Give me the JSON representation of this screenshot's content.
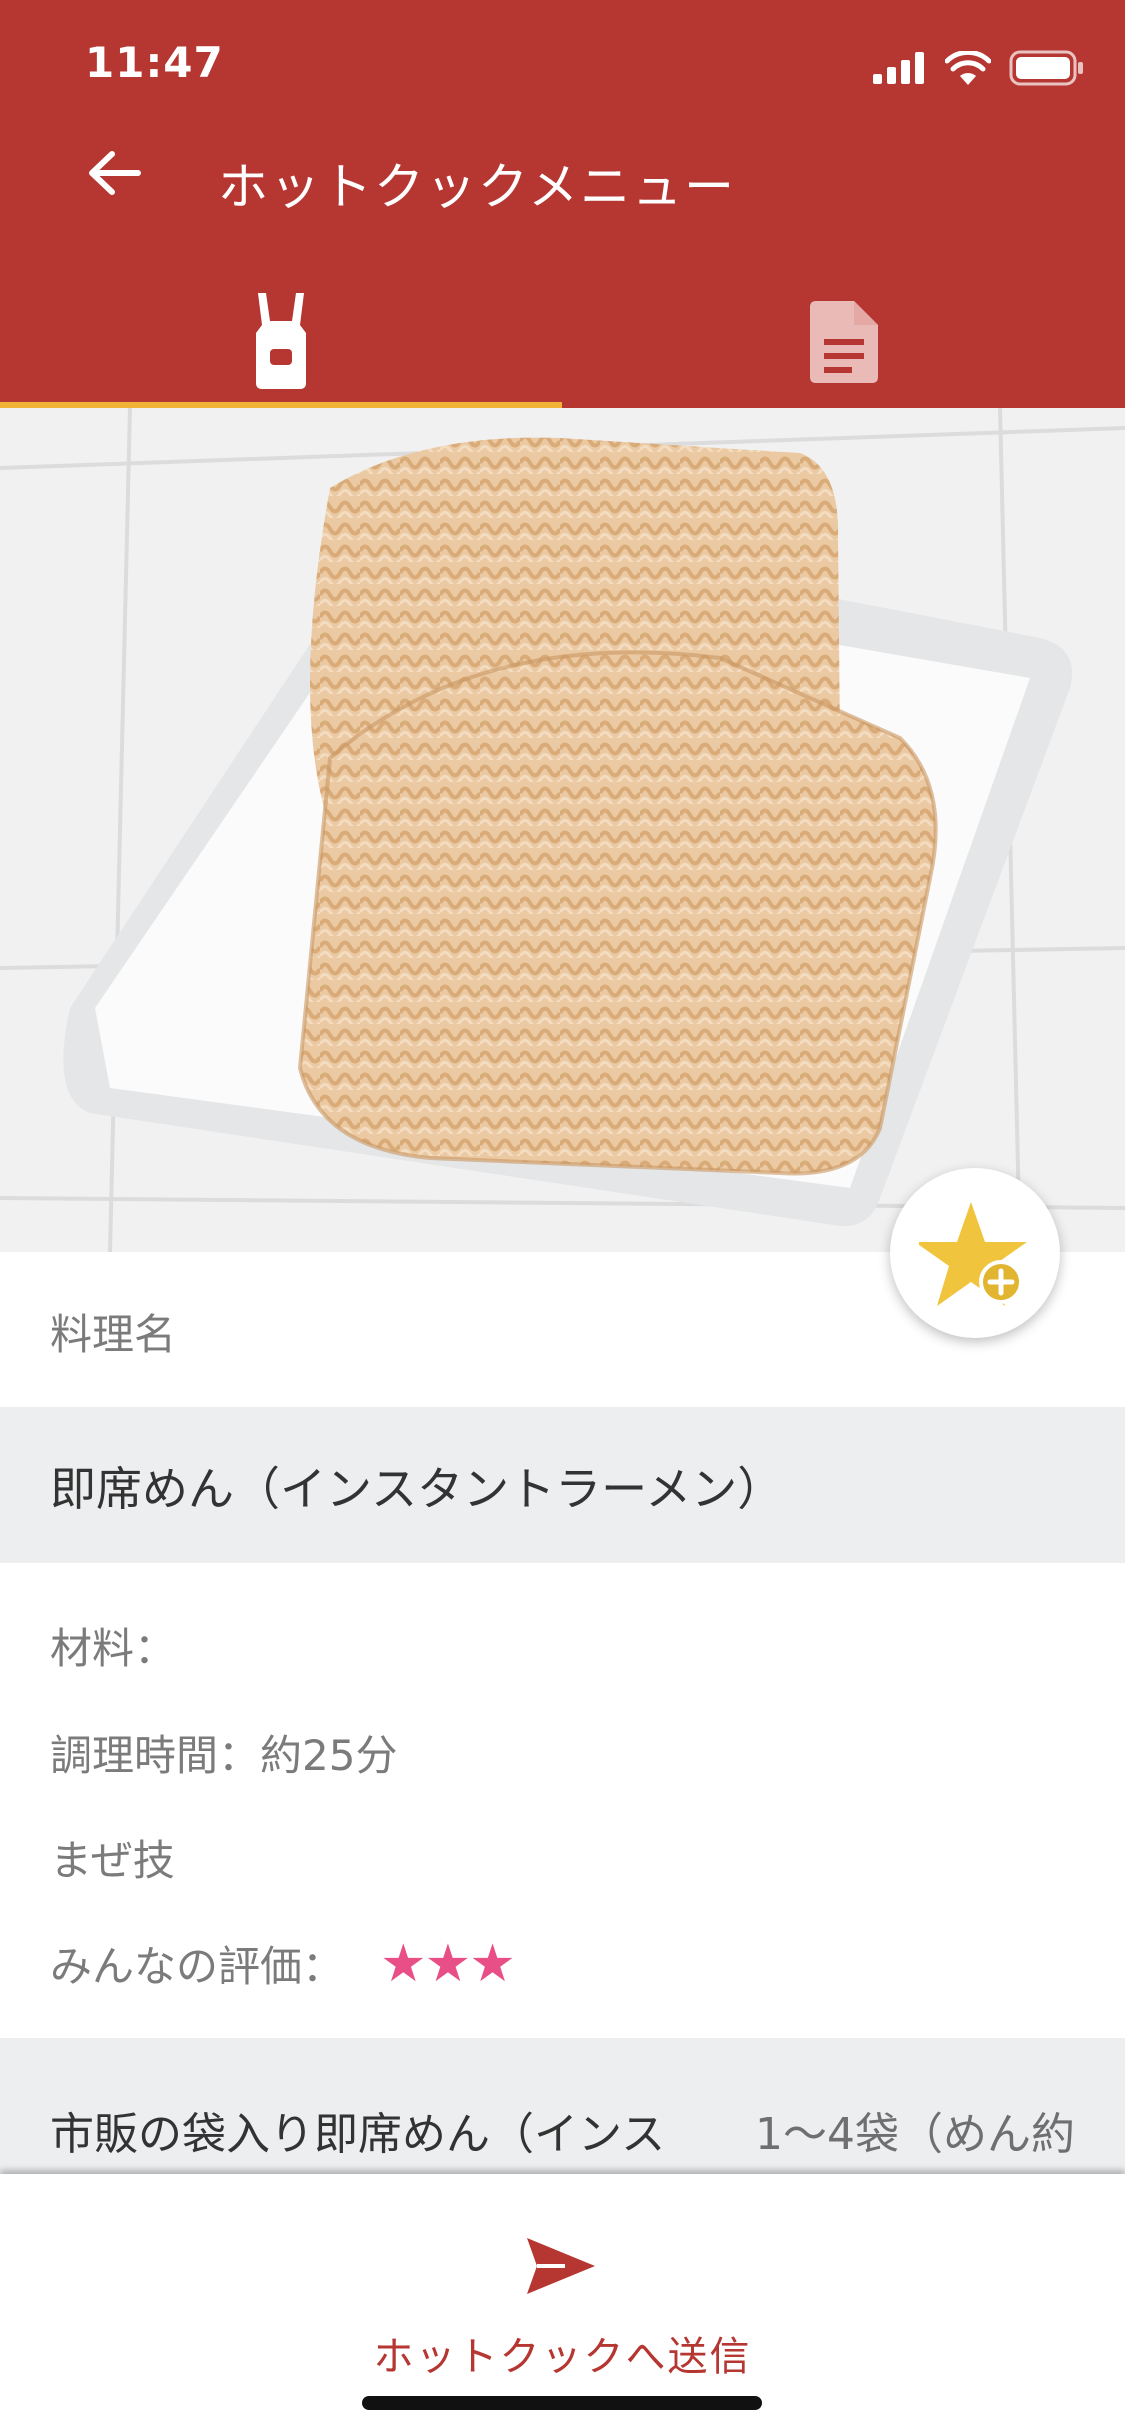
{
  "status": {
    "time": "11:47"
  },
  "header": {
    "title": "ホットクックメニュー"
  },
  "tabs": [
    {
      "icon": "apron-icon",
      "active": true
    },
    {
      "icon": "document-icon",
      "active": false
    }
  ],
  "recipe": {
    "name_label": "料理名",
    "name": "即席めん（インスタントラーメン）",
    "ingredients_label": "材料：",
    "time_label": "調理時間：約25分",
    "technique_label": "まぜ技",
    "rating_label": "みんなの評価：",
    "rating_stars": "★★★",
    "rating": 3
  },
  "ingredients": [
    {
      "name": "市販の袋入り即席めん（インス",
      "qty": "1〜4袋（めん約"
    }
  ],
  "bottom": {
    "send_label": "ホットクックへ送信"
  },
  "colors": {
    "primary": "#b63631",
    "accent": "#f1b336",
    "star": "#e74f86"
  }
}
